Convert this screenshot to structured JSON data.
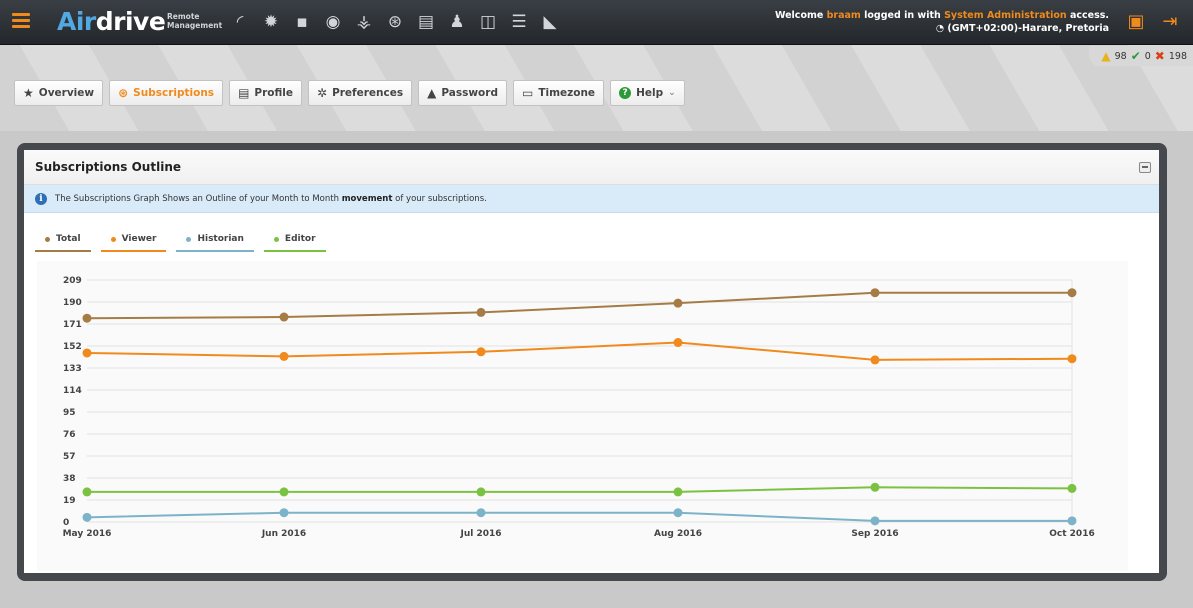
{
  "app": {
    "logo_part1": "Air",
    "logo_part2": "drive",
    "logo_sub_line1": "Remote",
    "logo_sub_line2": "Management",
    "welcome_prefix": "Welcome ",
    "user": "braam",
    "welcome_mid": " logged in with ",
    "role": "System Administration",
    "welcome_suffix": " access.",
    "timezone": "(GMT+02:00)-Harare, Pretoria",
    "accent": "#f08a1c"
  },
  "topnav_icons": [
    "gauge-icon",
    "gear-icon",
    "grid-icon",
    "eye-icon",
    "sitemap-icon",
    "subscriptions-icon",
    "document-icon",
    "users-icon",
    "book-icon",
    "list-icon",
    "bell-icon"
  ],
  "counters": {
    "warnings": "98",
    "ok": "0",
    "errors": "198"
  },
  "tabs": [
    {
      "label": "Overview",
      "icon": "star-icon"
    },
    {
      "label": "Subscriptions",
      "icon": "subscriptions-icon"
    },
    {
      "label": "Profile",
      "icon": "briefcase-icon"
    },
    {
      "label": "Preferences",
      "icon": "gear-icon"
    },
    {
      "label": "Password",
      "icon": "lock-icon"
    },
    {
      "label": "Timezone",
      "icon": "calendar-icon"
    },
    {
      "label": "Help",
      "icon": "question-icon"
    }
  ],
  "panel": {
    "title": "Subscriptions Outline",
    "info_prefix": "The Subscriptions Graph Shows an Outline of your Month to Month ",
    "info_bold": "movement",
    "info_suffix": " of your subscriptions."
  },
  "chart_data": {
    "type": "line",
    "categories": [
      "May 2016",
      "Jun 2016",
      "Jul 2016",
      "Aug 2016",
      "Sep 2016",
      "Oct 2016"
    ],
    "yticks": [
      0,
      19,
      38,
      57,
      76,
      95,
      114,
      133,
      152,
      171,
      190,
      209
    ],
    "ylim": [
      0,
      209
    ],
    "grid": true,
    "series": [
      {
        "name": "Total",
        "color": "#a67c46",
        "values": [
          176,
          177,
          181,
          189,
          198,
          198
        ]
      },
      {
        "name": "Viewer",
        "color": "#f08a1c",
        "values": [
          146,
          143,
          147,
          155,
          140,
          141
        ]
      },
      {
        "name": "Historian",
        "color": "#7db3c8",
        "values": [
          4,
          8,
          8,
          8,
          1,
          1
        ]
      },
      {
        "name": "Editor",
        "color": "#7cc242",
        "values": [
          26,
          26,
          26,
          26,
          30,
          29
        ]
      }
    ]
  }
}
